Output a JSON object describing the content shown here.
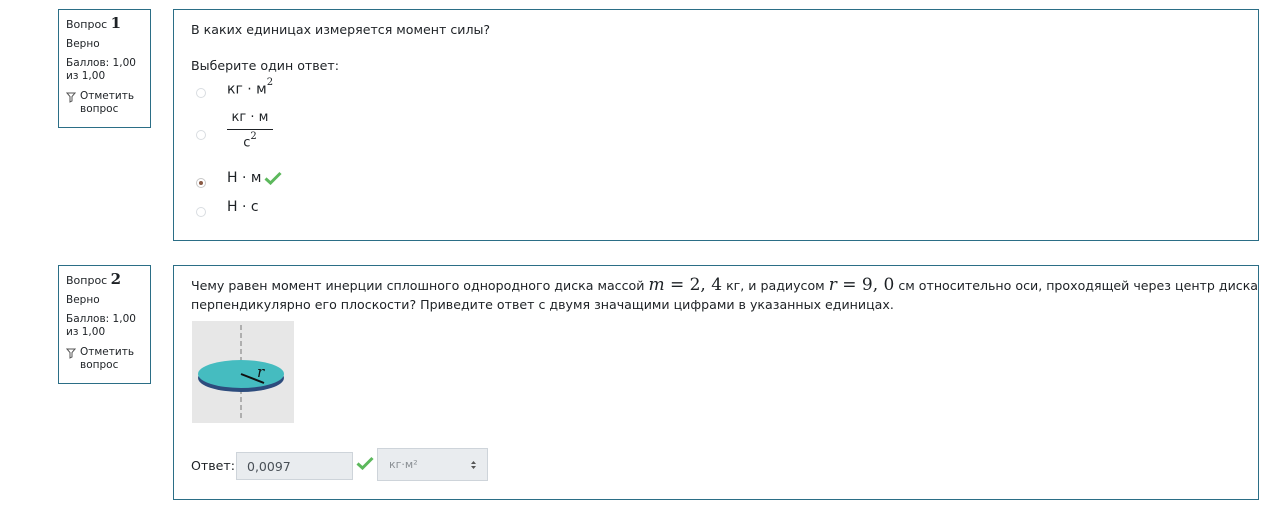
{
  "questions": [
    {
      "label": "Вопрос",
      "number": "1",
      "status": "Верно",
      "score": "Баллов: 1,00 из 1,00",
      "flag_label": "Отметить вопрос",
      "text": "В каких единицах измеряется момент силы?",
      "prompt": "Выберите один ответ:",
      "options": [
        {
          "label": "кг · м",
          "sup": "2",
          "selected": false
        },
        {
          "numerator": "кг · м",
          "denominator": "с",
          "den_sup": "2",
          "selected": false
        },
        {
          "label": "Н · м",
          "selected": true,
          "correct": true
        },
        {
          "label": "Н · с",
          "selected": false
        }
      ]
    },
    {
      "label": "Вопрос",
      "number": "2",
      "status": "Верно",
      "score": "Баллов: 1,00 из 1,00",
      "flag_label": "Отметить вопрос",
      "text_parts": {
        "t1": "Чему равен момент инерции сплошного однородного диска массой",
        "m_var": "m",
        "m_eq": " = 2, 4",
        "t2": "кг, и радиусом",
        "r_var": "r",
        "r_eq": " = 9, 0",
        "t3": "см относительно оси, проходящей через центр диска",
        "line2": "перпендикулярно его плоскости? Приведите ответ с двумя значащими цифрами в указанных единицах."
      },
      "figure_label": "r",
      "answer_label": "Ответ:",
      "answer_value": "0,0097",
      "unit_selected": "кг·м²",
      "correct": true
    }
  ],
  "colors": {
    "border": "#2b6e86",
    "correct": "#5cb85c",
    "input_bg": "#e9ecef",
    "disk": "#45bcc0"
  }
}
